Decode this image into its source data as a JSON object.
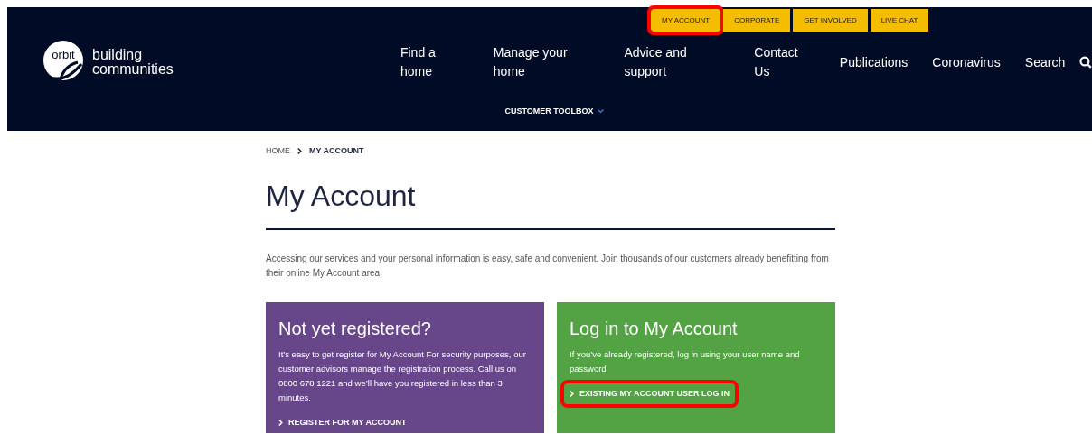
{
  "header": {
    "logo_mark": "orbit",
    "logo_text": [
      "building",
      "communities"
    ],
    "top_links": [
      {
        "label": "MY ACCOUNT",
        "highlighted": true
      },
      {
        "label": "CORPORATE",
        "highlighted": false
      },
      {
        "label": "GET INVOLVED",
        "highlighted": false
      },
      {
        "label": "LIVE CHAT",
        "highlighted": false
      }
    ],
    "nav": [
      "Find a home",
      "Manage your home",
      "Advice and support",
      "Contact Us",
      "Publications",
      "Coronavirus",
      "Search"
    ],
    "toolbox": "CUSTOMER TOOLBOX"
  },
  "breadcrumb": [
    "HOME",
    "MY ACCOUNT"
  ],
  "title": "My Account",
  "intro": "Accessing our services and your personal information is easy, safe and convenient. Join thousands of our customers already benefitting from their online My Account area",
  "cards": [
    {
      "title": "Not yet registered?",
      "text": "It’s easy to get register for My Account For security purposes, our customer advisors manage the registration process. Call us on 0800 678 1221 and we’ll have you registered in less than 3 minutes.",
      "color": "#68468a",
      "link": "REGISTER FOR MY ACCOUNT",
      "highlighted": false
    },
    {
      "title": "Log in to My Account",
      "text": "If you’ve already registered, log in using your user name and password",
      "color": "#53a243",
      "link": "EXISTING MY ACCOUNT USER LOG IN",
      "highlighted": true
    }
  ]
}
